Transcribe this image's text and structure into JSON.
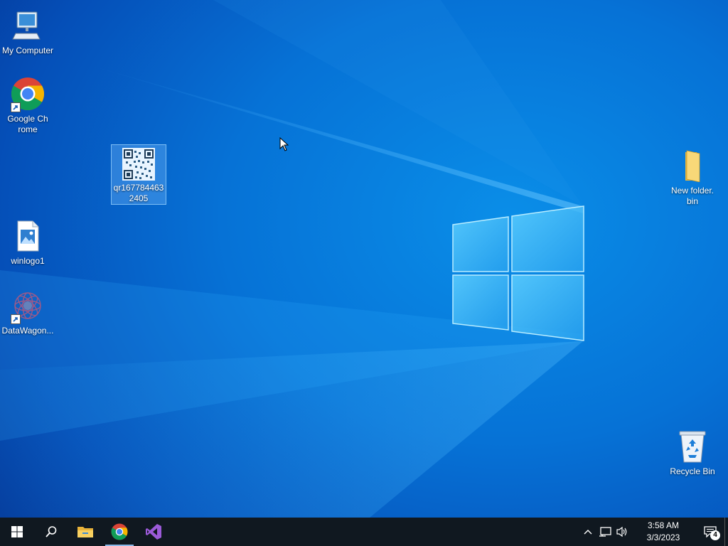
{
  "desktop": {
    "icons": [
      {
        "label": "My Computer",
        "icon": "computer-icon"
      },
      {
        "label": "Google Chrome",
        "icon": "chrome-icon",
        "shortcut": true
      },
      {
        "label": "qr1677844632405",
        "icon": "qr-image-icon",
        "selected": true
      },
      {
        "label": "winlogo1",
        "icon": "image-file-icon"
      },
      {
        "label": "DataWagon...",
        "icon": "datawagon-icon",
        "shortcut": true
      },
      {
        "label": "New folder.bin",
        "icon": "folder-icon"
      },
      {
        "label": "Recycle Bin",
        "icon": "recycle-bin-icon"
      }
    ]
  },
  "taskbar": {
    "buttons": [
      {
        "name": "start",
        "icon": "windows-start-icon"
      },
      {
        "name": "search",
        "icon": "search-icon"
      },
      {
        "name": "file-explorer",
        "icon": "folder-icon"
      },
      {
        "name": "chrome",
        "icon": "chrome-icon",
        "active": true
      },
      {
        "name": "visual-studio",
        "icon": "visual-studio-icon"
      }
    ],
    "tray": {
      "icons": [
        "chevron-up-icon",
        "network-icon",
        "volume-icon"
      ],
      "time": "3:58 AM",
      "date": "3/3/2023",
      "notification_count": "4"
    }
  },
  "colors": {
    "wallpaper": "#0672d6",
    "taskbar": "#101820",
    "selection": "#78beff"
  }
}
